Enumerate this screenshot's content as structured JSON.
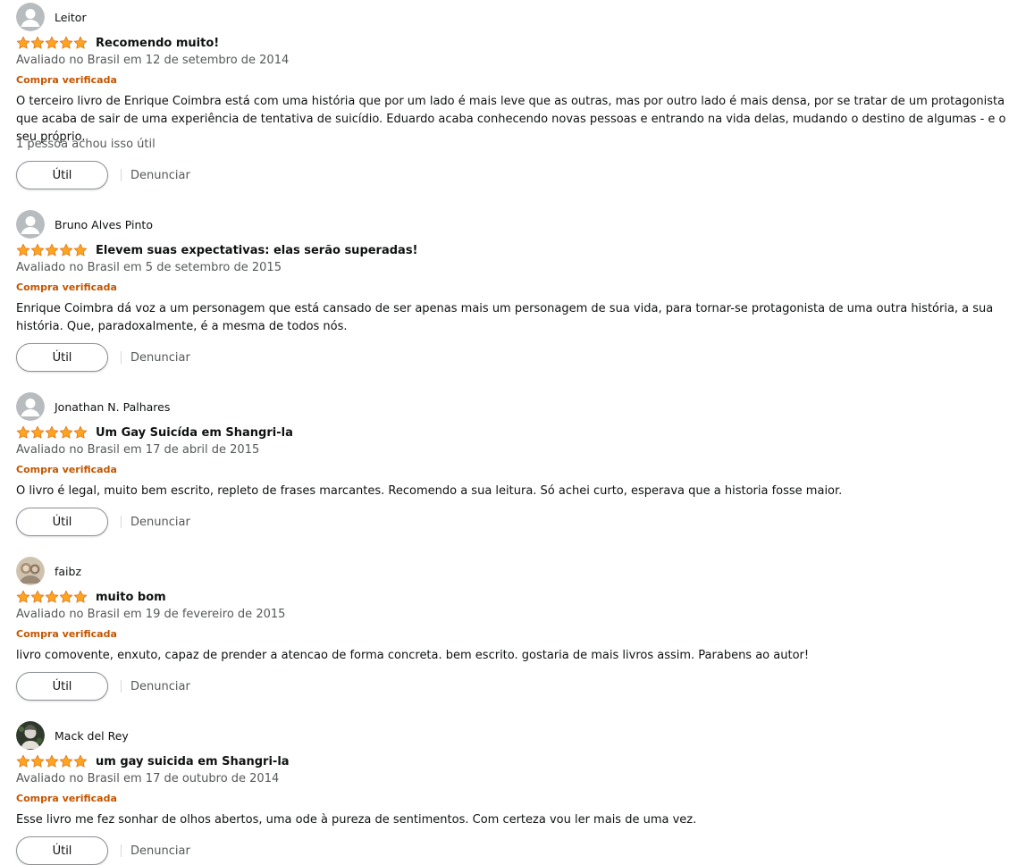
{
  "colors": {
    "star": "#ffa41c",
    "star_edge": "#de7921",
    "verified": "#c45500",
    "muted": "#565959"
  },
  "reviews": [
    {
      "reviewer": "Leitor",
      "avatar": "default-avatar-icon",
      "stars": 5,
      "title": "Recomendo muito!",
      "date": "Avaliado no Brasil em 12 de setembro de 2014",
      "verified": "Compra verificada",
      "body": "O terceiro livro de Enrique Coimbra está com uma história que por um lado é mais leve que as outras, mas por outro lado é mais densa, por se tratar de um protagonista que acaba de sair de uma experiência de tentativa de suicídio. Eduardo acaba conhecendo novas pessoas e entrando na vida delas, mudando o destino de algumas - e o seu próprio.",
      "helpful": "1 pessoa achou isso útil",
      "helpful_label": "Útil",
      "report_label": "Denunciar"
    },
    {
      "reviewer": "Bruno Alves Pinto",
      "avatar": "default-avatar-icon",
      "stars": 5,
      "title": "Elevem suas expectativas: elas serão superadas!",
      "date": "Avaliado no Brasil em 5 de setembro de 2015",
      "verified": "Compra verificada",
      "body": "Enrique Coimbra dá voz a um personagem que está cansado de ser apenas mais um personagem de sua vida, para tornar-se protagonista de uma outra história, a sua história. Que, paradoxalmente, é a mesma de todos nós.",
      "helpful_label": "Útil",
      "report_label": "Denunciar"
    },
    {
      "reviewer": "Jonathan N. Palhares",
      "avatar": "default-avatar-icon",
      "stars": 5,
      "title": "Um Gay Suicída em Shangri-la",
      "date": "Avaliado no Brasil em 17 de abril de 2015",
      "verified": "Compra verificada",
      "body": "O livro é legal, muito bem escrito, repleto de frases marcantes. Recomendo a sua leitura. Só achei curto, esperava que a historia fosse maior.",
      "helpful_label": "Útil",
      "report_label": "Denunciar"
    },
    {
      "reviewer": "faibz",
      "avatar": "photo-avatar-icon",
      "stars": 5,
      "title": "muito bom",
      "date": "Avaliado no Brasil em 19 de fevereiro de 2015",
      "verified": "Compra verificada",
      "body": "livro comovente, enxuto, capaz de prender a atencao de forma concreta. bem escrito. gostaria de mais livros assim. Parabens ao autor!",
      "helpful_label": "Útil",
      "report_label": "Denunciar"
    },
    {
      "reviewer": "Mack del Rey",
      "avatar": "photo-avatar-icon",
      "stars": 5,
      "title": "um gay suicida em Shangri-la",
      "date": "Avaliado no Brasil em 17 de outubro de 2014",
      "verified": "Compra verificada",
      "body": "Esse livro me fez sonhar de olhos abertos, uma ode à pureza de sentimentos. Com certeza vou ler mais de uma vez.",
      "helpful_label": "Útil",
      "report_label": "Denunciar"
    }
  ]
}
